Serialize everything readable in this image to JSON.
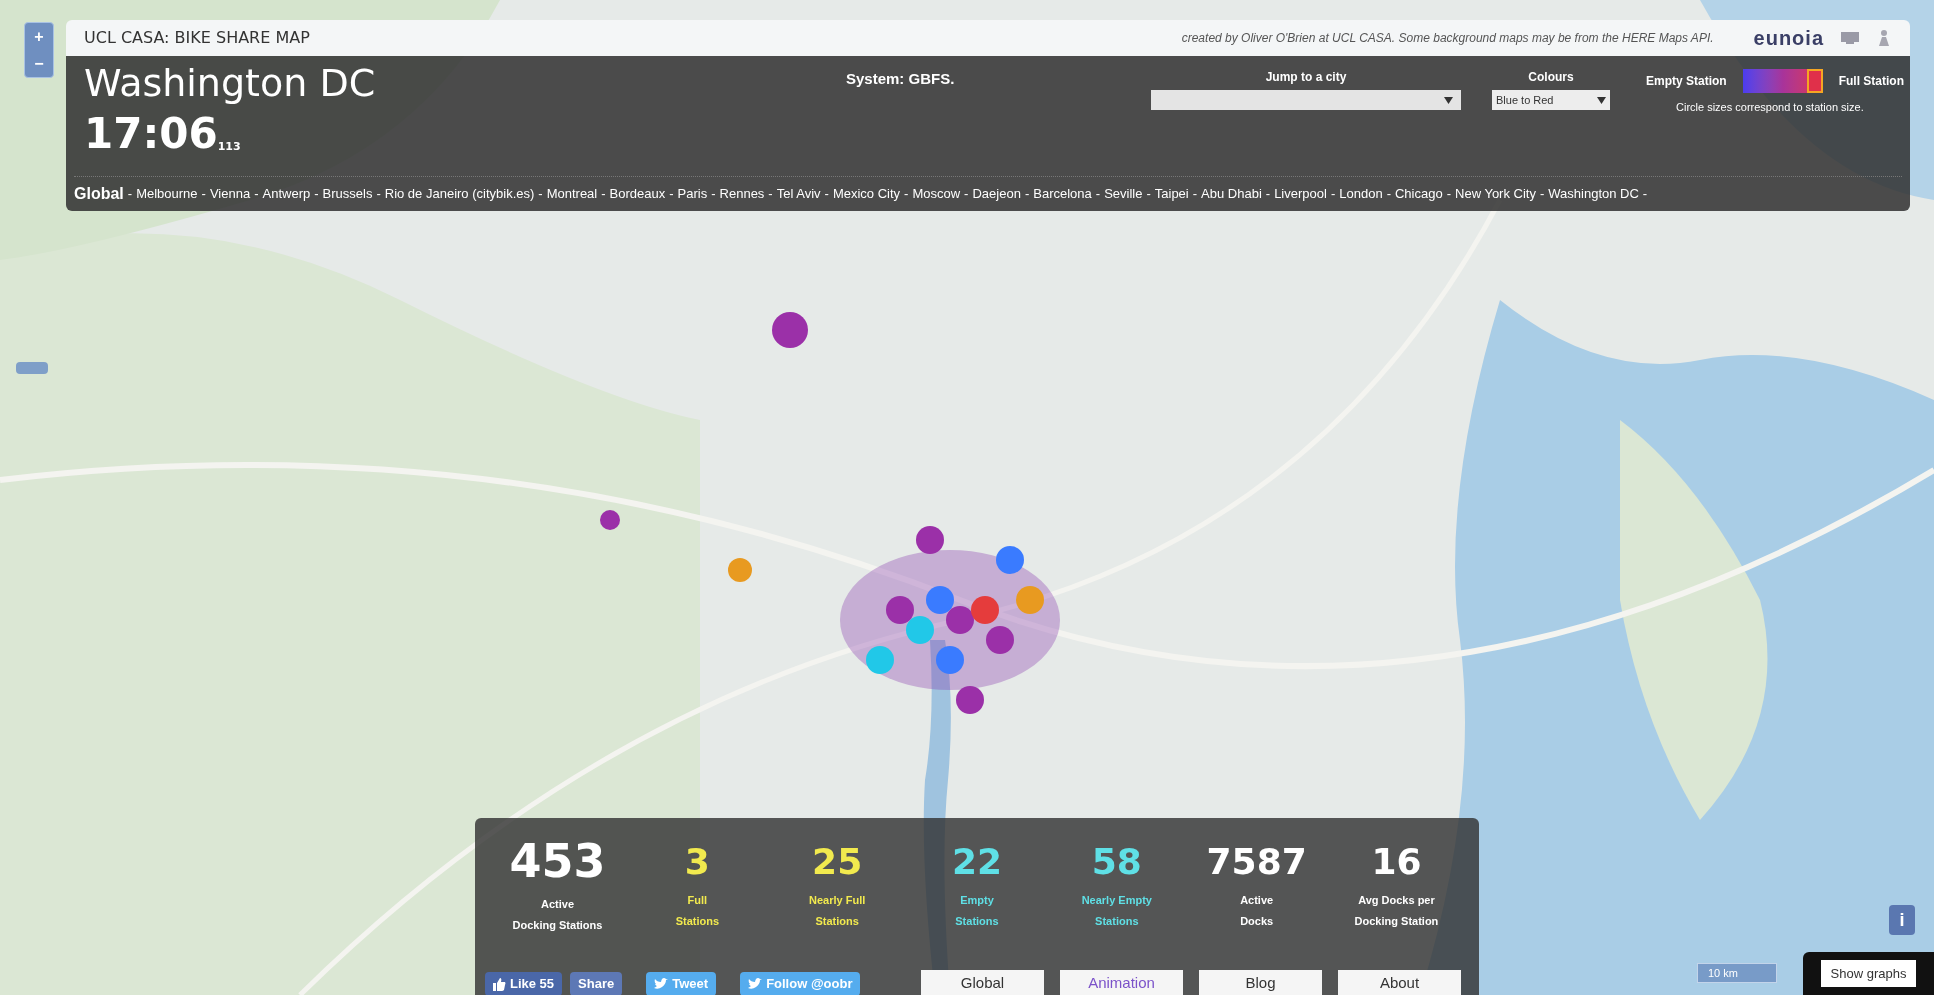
{
  "zoom_controls": [
    "+",
    "−"
  ],
  "header": {
    "title": "UCL CASA: BIKE SHARE MAP",
    "credit": "created by Oliver O'Brien at UCL CASA. Some background maps may be from the HERE Maps API.",
    "logo": "eunoia"
  },
  "panel": {
    "city": "Washington DC",
    "time": "17:06$_{113}$",
    "system": "System: GBFS.",
    "jump": {
      "label": "Jump to a city"
    },
    "colours": {
      "label": "Colours",
      "value": "Blue to Red"
    },
    "legend": {
      "empty": "Empty Station",
      "full": "Full Station",
      "note": "Circle sizes correspond to station size."
    },
    "cities": [
      {
        "name": "Global",
        "bold": true
      },
      {
        "name": "Melbourne",
        "bold": false
      },
      {
        "name": "Vienna",
        "bold": false
      },
      {
        "name": "Antwerp",
        "bold": false
      },
      {
        "name": "Brussels",
        "bold": false
      },
      {
        "name": "Rio de Janeiro (citybik.es)",
        "bold": false
      },
      {
        "name": "Montreal",
        "bold": false
      },
      {
        "name": "Bordeaux",
        "bold": false
      },
      {
        "name": "Paris",
        "bold": false
      },
      {
        "name": "Rennes",
        "bold": false
      },
      {
        "name": "Tel Aviv",
        "bold": false
      },
      {
        "name": "Mexico City",
        "bold": false
      },
      {
        "name": "Moscow",
        "bold": false
      },
      {
        "name": "Daejeon",
        "bold": false
      },
      {
        "name": "Barcelona",
        "bold": false
      },
      {
        "name": "Seville",
        "bold": false
      },
      {
        "name": "Taipei",
        "bold": false
      },
      {
        "name": "Abu Dhabi",
        "bold": false
      },
      {
        "name": "Liverpool",
        "bold": false
      },
      {
        "name": "London",
        "bold": false
      },
      {
        "name": "Chicago",
        "bold": false
      },
      {
        "name": "New York City",
        "bold": false
      },
      {
        "name": "Washington DC",
        "bold": false
      }
    ],
    "separator": "-"
  },
  "stats": [
    {
      "value": "453",
      "label": [
        "Active",
        "Docking Stations"
      ],
      "color": "#ffffff"
    },
    {
      "value": "3",
      "label": [
        "Full",
        "Stations"
      ],
      "color": "#f2ea4e"
    },
    {
      "value": "25",
      "label": [
        "Nearly Full",
        "Stations"
      ],
      "color": "#f2ea4e"
    },
    {
      "value": "22",
      "label": [
        "Empty",
        "Stations"
      ],
      "color": "#5fe0e6"
    },
    {
      "value": "58",
      "label": [
        "Nearly Empty",
        "Stations"
      ],
      "color": "#5fe0e6"
    },
    {
      "value": "7587",
      "label": [
        "Active",
        "Docks"
      ],
      "color": "#ffffff"
    },
    {
      "value": "16",
      "label": [
        "Avg Docks per",
        "Docking Station"
      ],
      "color": "#ffffff"
    }
  ],
  "social": [
    {
      "kind": "like",
      "label": "Like 55"
    },
    {
      "kind": "share",
      "label": "Share"
    },
    {
      "kind": "tweet",
      "label": "Tweet"
    },
    {
      "kind": "follow",
      "label": "Follow @oobr"
    }
  ],
  "nav": [
    {
      "label": "Global",
      "selected": false
    },
    {
      "label": "Animation",
      "selected": true
    },
    {
      "label": "Blog",
      "selected": false
    },
    {
      "label": "About",
      "selected": false
    }
  ],
  "info_button": "i",
  "scale": "10 km",
  "show_graphs": "Show graphs"
}
